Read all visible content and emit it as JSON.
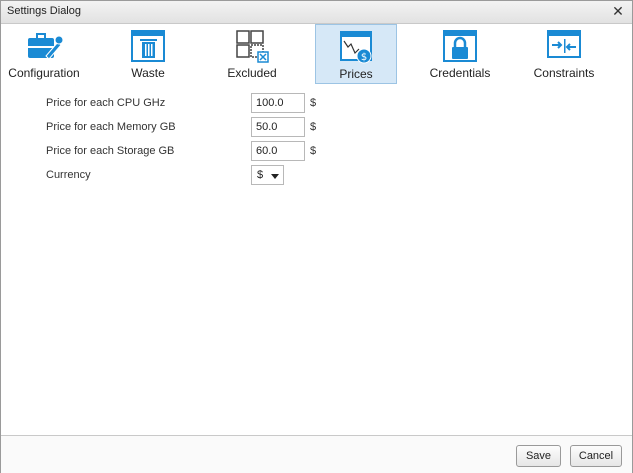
{
  "dialog": {
    "title": "Settings Dialog"
  },
  "tabs": [
    {
      "label": "Configuration",
      "icon": "configuration-icon"
    },
    {
      "label": "Waste",
      "icon": "trash-icon"
    },
    {
      "label": "Excluded",
      "icon": "excluded-grid-icon"
    },
    {
      "label": "Prices",
      "icon": "prices-chart-icon",
      "active": true
    },
    {
      "label": "Credentials",
      "icon": "lock-icon"
    },
    {
      "label": "Constraints",
      "icon": "constraints-arrows-icon"
    }
  ],
  "prices": {
    "cpu": {
      "label": "Price for each CPU GHz",
      "value": "100.0",
      "unit": "$"
    },
    "memory": {
      "label": "Price for each Memory GB",
      "value": "50.0",
      "unit": "$"
    },
    "storage": {
      "label": "Price for each Storage GB",
      "value": "60.0",
      "unit": "$"
    },
    "currency": {
      "label": "Currency",
      "value": "$"
    }
  },
  "footer": {
    "save": "Save",
    "cancel": "Cancel"
  },
  "colors": {
    "accent": "#1a8ad4",
    "active_tab_bg": "#d6e8f7"
  }
}
